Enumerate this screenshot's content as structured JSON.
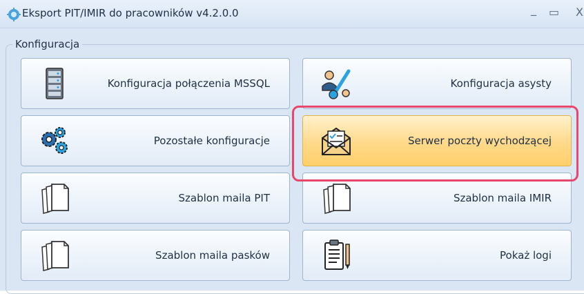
{
  "window": {
    "title": "Eksport PIT/IMIR do pracowników v4.2.0.0",
    "controls": {
      "minimize": "_",
      "maximize": "▭",
      "close": "X"
    }
  },
  "group": {
    "legend": "Konfiguracja"
  },
  "buttons": [
    {
      "label": "Konfiguracja połączenia MSSQL",
      "icon": "server-icon"
    },
    {
      "label": "Konfiguracja asysty",
      "icon": "assistant-key-icon"
    },
    {
      "label": "Pozostałe konfiguracje",
      "icon": "gears-icon"
    },
    {
      "label": "Serwer poczty wychodzącej",
      "icon": "envelope-icon",
      "state": "hover"
    },
    {
      "label": "Szablon maila PIT",
      "icon": "documents-icon"
    },
    {
      "label": "Szablon maila IMIR",
      "icon": "documents-icon"
    },
    {
      "label": "Szablon maila pasków",
      "icon": "documents-icon"
    },
    {
      "label": "Pokaż logi",
      "icon": "clipboard-icon"
    }
  ],
  "colors": {
    "highlight": "#e8476b",
    "hover": "#ffd98a",
    "background": "#dbe6f4"
  }
}
